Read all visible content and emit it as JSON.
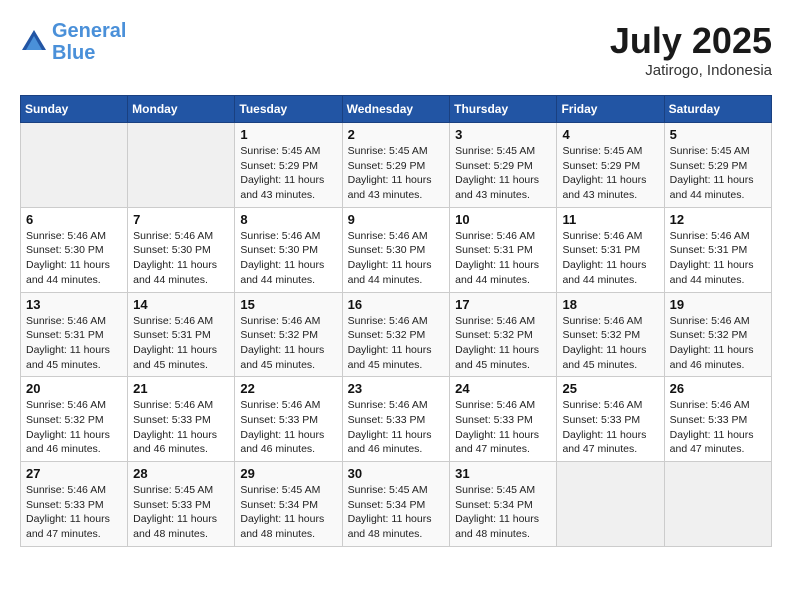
{
  "header": {
    "logo_line1": "General",
    "logo_line2": "Blue",
    "month": "July 2025",
    "location": "Jatirogo, Indonesia"
  },
  "days_of_week": [
    "Sunday",
    "Monday",
    "Tuesday",
    "Wednesday",
    "Thursday",
    "Friday",
    "Saturday"
  ],
  "weeks": [
    [
      {
        "day": "",
        "sunrise": "",
        "sunset": "",
        "daylight": ""
      },
      {
        "day": "",
        "sunrise": "",
        "sunset": "",
        "daylight": ""
      },
      {
        "day": "1",
        "sunrise": "Sunrise: 5:45 AM",
        "sunset": "Sunset: 5:29 PM",
        "daylight": "Daylight: 11 hours and 43 minutes."
      },
      {
        "day": "2",
        "sunrise": "Sunrise: 5:45 AM",
        "sunset": "Sunset: 5:29 PM",
        "daylight": "Daylight: 11 hours and 43 minutes."
      },
      {
        "day": "3",
        "sunrise": "Sunrise: 5:45 AM",
        "sunset": "Sunset: 5:29 PM",
        "daylight": "Daylight: 11 hours and 43 minutes."
      },
      {
        "day": "4",
        "sunrise": "Sunrise: 5:45 AM",
        "sunset": "Sunset: 5:29 PM",
        "daylight": "Daylight: 11 hours and 43 minutes."
      },
      {
        "day": "5",
        "sunrise": "Sunrise: 5:45 AM",
        "sunset": "Sunset: 5:29 PM",
        "daylight": "Daylight: 11 hours and 44 minutes."
      }
    ],
    [
      {
        "day": "6",
        "sunrise": "Sunrise: 5:46 AM",
        "sunset": "Sunset: 5:30 PM",
        "daylight": "Daylight: 11 hours and 44 minutes."
      },
      {
        "day": "7",
        "sunrise": "Sunrise: 5:46 AM",
        "sunset": "Sunset: 5:30 PM",
        "daylight": "Daylight: 11 hours and 44 minutes."
      },
      {
        "day": "8",
        "sunrise": "Sunrise: 5:46 AM",
        "sunset": "Sunset: 5:30 PM",
        "daylight": "Daylight: 11 hours and 44 minutes."
      },
      {
        "day": "9",
        "sunrise": "Sunrise: 5:46 AM",
        "sunset": "Sunset: 5:30 PM",
        "daylight": "Daylight: 11 hours and 44 minutes."
      },
      {
        "day": "10",
        "sunrise": "Sunrise: 5:46 AM",
        "sunset": "Sunset: 5:31 PM",
        "daylight": "Daylight: 11 hours and 44 minutes."
      },
      {
        "day": "11",
        "sunrise": "Sunrise: 5:46 AM",
        "sunset": "Sunset: 5:31 PM",
        "daylight": "Daylight: 11 hours and 44 minutes."
      },
      {
        "day": "12",
        "sunrise": "Sunrise: 5:46 AM",
        "sunset": "Sunset: 5:31 PM",
        "daylight": "Daylight: 11 hours and 44 minutes."
      }
    ],
    [
      {
        "day": "13",
        "sunrise": "Sunrise: 5:46 AM",
        "sunset": "Sunset: 5:31 PM",
        "daylight": "Daylight: 11 hours and 45 minutes."
      },
      {
        "day": "14",
        "sunrise": "Sunrise: 5:46 AM",
        "sunset": "Sunset: 5:31 PM",
        "daylight": "Daylight: 11 hours and 45 minutes."
      },
      {
        "day": "15",
        "sunrise": "Sunrise: 5:46 AM",
        "sunset": "Sunset: 5:32 PM",
        "daylight": "Daylight: 11 hours and 45 minutes."
      },
      {
        "day": "16",
        "sunrise": "Sunrise: 5:46 AM",
        "sunset": "Sunset: 5:32 PM",
        "daylight": "Daylight: 11 hours and 45 minutes."
      },
      {
        "day": "17",
        "sunrise": "Sunrise: 5:46 AM",
        "sunset": "Sunset: 5:32 PM",
        "daylight": "Daylight: 11 hours and 45 minutes."
      },
      {
        "day": "18",
        "sunrise": "Sunrise: 5:46 AM",
        "sunset": "Sunset: 5:32 PM",
        "daylight": "Daylight: 11 hours and 45 minutes."
      },
      {
        "day": "19",
        "sunrise": "Sunrise: 5:46 AM",
        "sunset": "Sunset: 5:32 PM",
        "daylight": "Daylight: 11 hours and 46 minutes."
      }
    ],
    [
      {
        "day": "20",
        "sunrise": "Sunrise: 5:46 AM",
        "sunset": "Sunset: 5:32 PM",
        "daylight": "Daylight: 11 hours and 46 minutes."
      },
      {
        "day": "21",
        "sunrise": "Sunrise: 5:46 AM",
        "sunset": "Sunset: 5:33 PM",
        "daylight": "Daylight: 11 hours and 46 minutes."
      },
      {
        "day": "22",
        "sunrise": "Sunrise: 5:46 AM",
        "sunset": "Sunset: 5:33 PM",
        "daylight": "Daylight: 11 hours and 46 minutes."
      },
      {
        "day": "23",
        "sunrise": "Sunrise: 5:46 AM",
        "sunset": "Sunset: 5:33 PM",
        "daylight": "Daylight: 11 hours and 46 minutes."
      },
      {
        "day": "24",
        "sunrise": "Sunrise: 5:46 AM",
        "sunset": "Sunset: 5:33 PM",
        "daylight": "Daylight: 11 hours and 47 minutes."
      },
      {
        "day": "25",
        "sunrise": "Sunrise: 5:46 AM",
        "sunset": "Sunset: 5:33 PM",
        "daylight": "Daylight: 11 hours and 47 minutes."
      },
      {
        "day": "26",
        "sunrise": "Sunrise: 5:46 AM",
        "sunset": "Sunset: 5:33 PM",
        "daylight": "Daylight: 11 hours and 47 minutes."
      }
    ],
    [
      {
        "day": "27",
        "sunrise": "Sunrise: 5:46 AM",
        "sunset": "Sunset: 5:33 PM",
        "daylight": "Daylight: 11 hours and 47 minutes."
      },
      {
        "day": "28",
        "sunrise": "Sunrise: 5:45 AM",
        "sunset": "Sunset: 5:33 PM",
        "daylight": "Daylight: 11 hours and 48 minutes."
      },
      {
        "day": "29",
        "sunrise": "Sunrise: 5:45 AM",
        "sunset": "Sunset: 5:34 PM",
        "daylight": "Daylight: 11 hours and 48 minutes."
      },
      {
        "day": "30",
        "sunrise": "Sunrise: 5:45 AM",
        "sunset": "Sunset: 5:34 PM",
        "daylight": "Daylight: 11 hours and 48 minutes."
      },
      {
        "day": "31",
        "sunrise": "Sunrise: 5:45 AM",
        "sunset": "Sunset: 5:34 PM",
        "daylight": "Daylight: 11 hours and 48 minutes."
      },
      {
        "day": "",
        "sunrise": "",
        "sunset": "",
        "daylight": ""
      },
      {
        "day": "",
        "sunrise": "",
        "sunset": "",
        "daylight": ""
      }
    ]
  ]
}
